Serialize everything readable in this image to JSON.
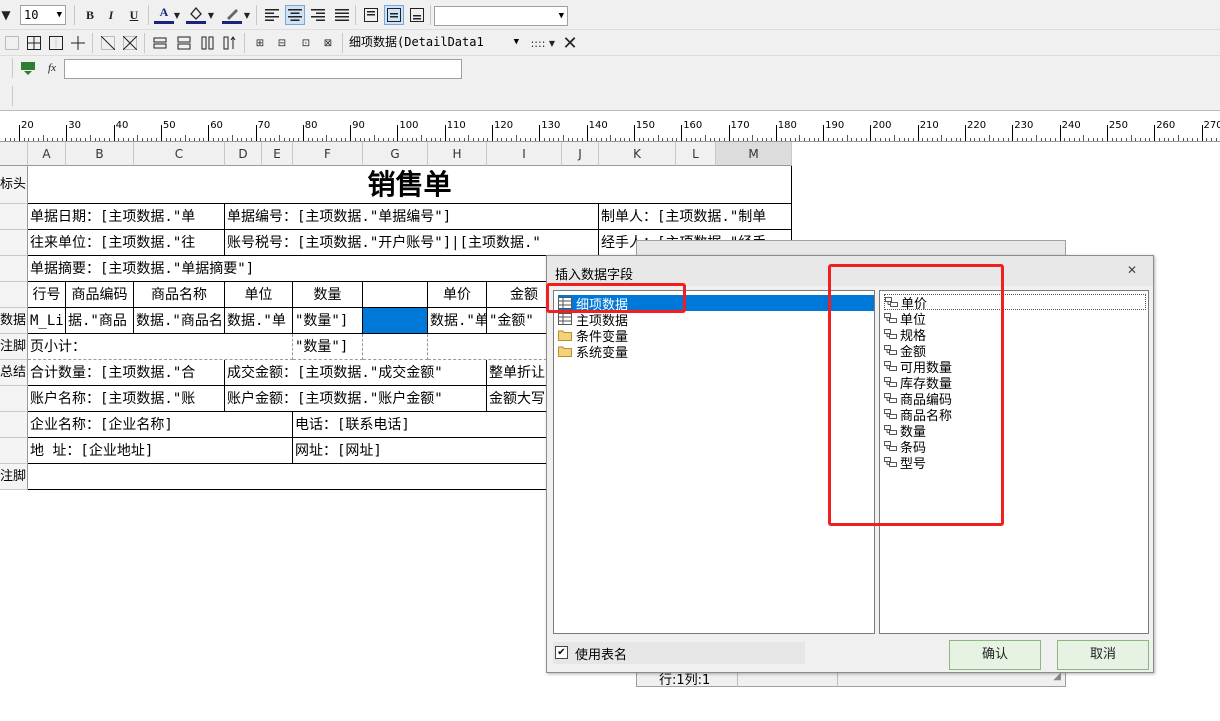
{
  "toolbar1": {
    "font_size": "10",
    "bold": "B",
    "italic": "I",
    "underline": "U",
    "font_color": "A",
    "style_combo": ""
  },
  "toolbar2": {
    "data_source_combo": "细项数据(DetailData1",
    "dots": "::::"
  },
  "toolbar3": {
    "fx_label": "fx",
    "formula_value": ""
  },
  "ruler": {
    "labels": [
      "20",
      "30",
      "40",
      "50",
      "60",
      "70",
      "80",
      "90",
      "100",
      "110",
      "120",
      "130",
      "140",
      "150",
      "160",
      "170",
      "180",
      "190",
      "200",
      "210",
      "220",
      "230",
      "240",
      "250",
      "260",
      "270"
    ]
  },
  "grid": {
    "columns": [
      "A",
      "B",
      "C",
      "D",
      "E",
      "F",
      "G",
      "H",
      "I",
      "J",
      "K",
      "L",
      "M"
    ],
    "row_headers": [
      "标头",
      "",
      "",
      "",
      "",
      "数据",
      "注脚",
      "总结",
      "",
      "",
      "",
      "注脚"
    ],
    "title": "销售单",
    "r2": {
      "c1": "单据日期：[主项数据.\"单",
      "c2": "单据编号：[主项数据.\"单据编号\"]",
      "c3": "制单人：[主项数据.\"制单"
    },
    "r3": {
      "c1": "往来单位：[主项数据.\"往",
      "c2": "账号税号：[主项数据.\"开户账号\"]|[主项数据.\"",
      "c3": "经手人：[主项数据.\"经手"
    },
    "r4": {
      "c1": "单据摘要：[主项数据.\"单据摘要\"]"
    },
    "r5": [
      "行号",
      "商品编码",
      "商品名称",
      "单位",
      "数量",
      "",
      "单价",
      "金额"
    ],
    "r6": [
      "M_Li",
      "据.\"商品",
      "数据.\"商品名",
      "数据.\"单",
      "\"数量\"]",
      "",
      "数据.\"单",
      "\"金额\""
    ],
    "r7": {
      "c1": "页小计：",
      "c2": "\"数量\"]"
    },
    "r8": {
      "c1": "合计数量：[主项数据.\"合",
      "c2": "成交金额：[主项数据.\"成交金额\"",
      "c3": "整单折让"
    },
    "r9": {
      "c1": "账户名称：[主项数据.\"账",
      "c2": "账户金额：[主项数据.\"账户金额\"",
      "c3": "金额大写"
    },
    "r10": {
      "c1": "企业名称：[企业名称]",
      "c2": "电话：[联系电话]"
    },
    "r11": {
      "c1": "地   址：[企业地址]",
      "c2": "网址：[网址]"
    }
  },
  "bg_dialog": {
    "title": "",
    "status": "行:1列:1"
  },
  "dialog": {
    "title": "插入数据字段",
    "tree": [
      "细项数据",
      "主项数据",
      "条件变量",
      "系统变量"
    ],
    "fields": [
      "单价",
      "单位",
      "规格",
      "金额",
      "可用数量",
      "库存数量",
      "商品编码",
      "商品名称",
      "数量",
      "条码",
      "型号"
    ],
    "use_table_name": "使用表名",
    "use_table_name_checked": true,
    "ok": "确认",
    "cancel": "取消"
  },
  "colors": {
    "highlight_annotation": "#f02020",
    "selection": "#0078d7",
    "toolbar_bg": "#f0f0f0"
  }
}
